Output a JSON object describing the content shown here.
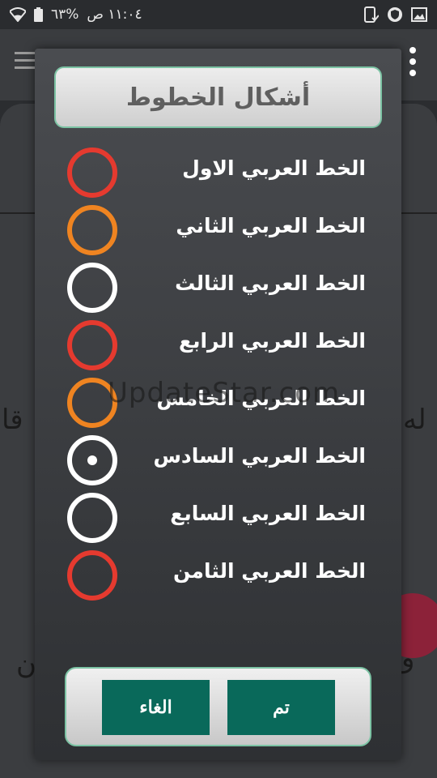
{
  "status_bar": {
    "time": "١١:٠٤ ص",
    "battery_percent": "%٦٣",
    "icons_left": [
      "battery-icon",
      "wifi-icon"
    ],
    "icons_right": [
      "screen-record-icon",
      "shield-icon",
      "gallery-icon"
    ]
  },
  "background": {
    "text_left_top": "قا",
    "text_right_top": "له",
    "text_left_bottom": "ن",
    "text_right_bottom": "و",
    "fab_color": "#8c2239"
  },
  "watermark": "UpdateStar.com",
  "dialog": {
    "title": "أشكال الخطوط",
    "options": [
      {
        "label": "الخط العربي الاول",
        "color": "#e53a2f",
        "selected": false
      },
      {
        "label": "الخط العربي الثاني",
        "color": "#ef8421",
        "selected": false
      },
      {
        "label": "الخط العربي الثالث",
        "color": "#ffffff",
        "selected": false
      },
      {
        "label": "الخط العربي الرابع",
        "color": "#e53a2f",
        "selected": false
      },
      {
        "label": "الخط العربي الخامس",
        "color": "#ef8421",
        "selected": false
      },
      {
        "label": "الخط العربي السادس",
        "color": "#ffffff",
        "selected": true
      },
      {
        "label": "الخط العربي السابع",
        "color": "#ffffff",
        "selected": false
      },
      {
        "label": "الخط العربي الثامن",
        "color": "#e53a2f",
        "selected": false
      }
    ],
    "ok_label": "تم",
    "cancel_label": "الغاء",
    "accent_color": "#09695a"
  }
}
